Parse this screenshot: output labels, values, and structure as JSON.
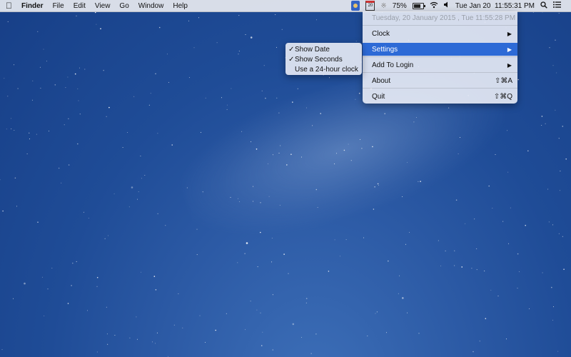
{
  "menubar": {
    "apple_icon": "apple-icon",
    "app_name": "Finder",
    "menus": [
      "File",
      "Edit",
      "View",
      "Go",
      "Window",
      "Help"
    ],
    "calendar_day": "20",
    "battery_percent": "75%",
    "battery_level": 0.75,
    "date_time": "Tue Jan 20  11:55:31 PM"
  },
  "clock_menu": {
    "header": "Tuesday, 20 January 2015 , Tue 11:55:28 PM",
    "items": [
      {
        "label": "Clock"
      },
      {
        "label": "Settings"
      },
      {
        "label": "Add To Login"
      },
      {
        "label": "About",
        "shortcut": "⇧⌘A"
      },
      {
        "label": "Quit",
        "shortcut": "⇧⌘Q"
      }
    ]
  },
  "settings_submenu": {
    "items": [
      {
        "label": "Show Date",
        "check": "✓"
      },
      {
        "label": "Show Seconds",
        "check": "✓"
      },
      {
        "label": "Use a 24-hour clock",
        "check": ""
      }
    ]
  },
  "colors": {
    "accent": "#2d6ad6",
    "desktop": "#1f4c97"
  }
}
